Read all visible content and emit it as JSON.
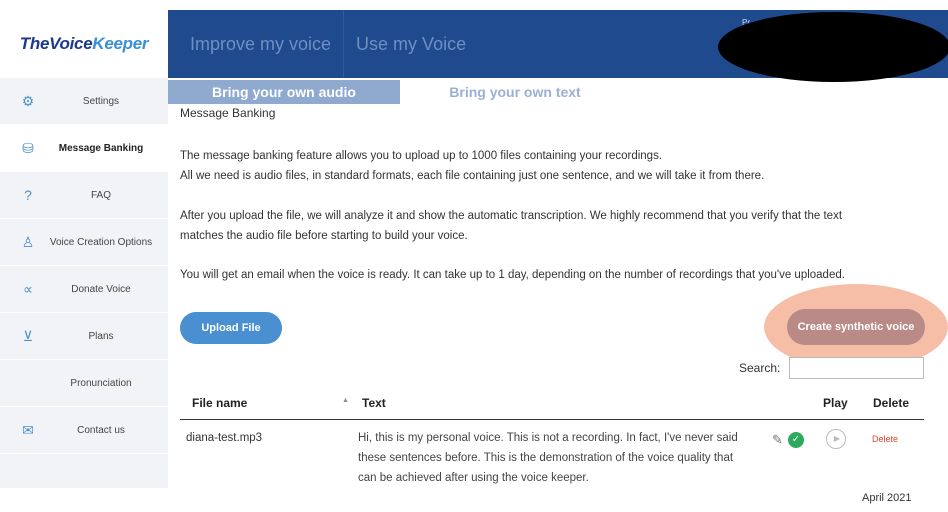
{
  "app": {
    "logo_part1": "TheVoice",
    "logo_part2": "Keeper"
  },
  "topnav": {
    "items": [
      {
        "label": "Improve my voice"
      },
      {
        "label": "Use my Voice"
      }
    ],
    "profile_partial": "Pr"
  },
  "sidebar": {
    "items": [
      {
        "label": "Settings",
        "icon": "gear-icon"
      },
      {
        "label": "Message Banking",
        "icon": "database-icon",
        "active": true
      },
      {
        "label": "FAQ",
        "icon": "question-icon"
      },
      {
        "label": "Voice Creation Options",
        "icon": "person-icon"
      },
      {
        "label": "Donate Voice",
        "icon": "share-icon"
      },
      {
        "label": "Plans",
        "icon": "cart-icon"
      },
      {
        "label": "Pronunciation",
        "icon": ""
      },
      {
        "label": "Contact us",
        "icon": "mail-icon"
      }
    ]
  },
  "subtabs": {
    "active": "Bring your own audio",
    "inactive": "Bring your own text"
  },
  "main": {
    "section_title": "Message Banking",
    "p1_line1": "The message banking feature allows you to upload up to 1000 files containing your recordings.",
    "p1_line2": "All we need is audio files, in standard formats, each file containing just one sentence, and we will take it from there.",
    "p2_line1": "After you upload the file, we will analyze it and show the automatic transcription. We highly recommend that you verify that the text",
    "p2_line2": "matches the audio file before starting to build your voice.",
    "p3": "You will get an email when the voice is ready. It can take up to 1 day, depending on the number of recordings that you've uploaded.",
    "upload_label": "Upload File",
    "create_label": "Create synthetic voice",
    "search_label": "Search:",
    "search_value": ""
  },
  "table": {
    "headers": {
      "file": "File name",
      "text": "Text",
      "play": "Play",
      "delete": "Delete"
    },
    "rows": [
      {
        "file": "diana-test.mp3",
        "text": "Hi, this is my personal voice. This is not a recording. In fact, I've never said these sentences before. This is the demonstration of the voice quality that can be achieved after using the voice keeper.",
        "delete": "Delete"
      }
    ]
  },
  "footer": {
    "date": "April 2021"
  },
  "colors": {
    "topbar": "#1f4a8e",
    "sidebar": "#f1f3f6",
    "upload_button": "#4a90d0",
    "synth_button": "#b98a86",
    "highlight": "#f6bea6",
    "delete": "#e0452d"
  }
}
